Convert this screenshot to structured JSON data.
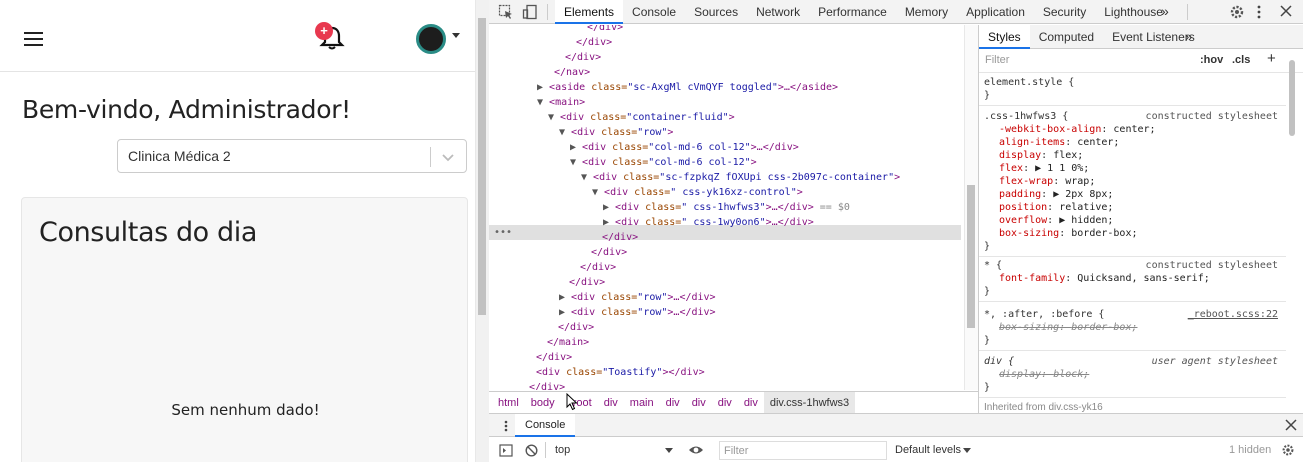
{
  "app": {
    "welcome": "Bem-vindo, Administrador!",
    "clinic_selected": "Clinica Médica 2",
    "notification_badge": "+",
    "card_title": "Consultas do dia",
    "empty_message": "Sem nenhum dado!"
  },
  "devtools": {
    "tabs": [
      "Elements",
      "Console",
      "Sources",
      "Network",
      "Performance",
      "Memory",
      "Application",
      "Security",
      "Lighthouse"
    ],
    "more_tabs": "»",
    "dom": [
      {
        "text": "</div>"
      },
      {
        "text": "</div>"
      },
      {
        "text": "</div>"
      },
      {
        "text": "</nav>"
      },
      {
        "tw": "▶",
        "tag": "<aside",
        "attr": " class=",
        "val": "\"sc-AxgMl cVmQYF toggled\"",
        "rest": ">…</aside>"
      },
      {
        "tw": "▼",
        "tag": "<main>"
      },
      {
        "tw": "▼",
        "tag": "<div",
        "attr": " class=",
        "val": "\"container-fluid\"",
        "rest": ">"
      },
      {
        "tw": "▼",
        "tag": "<div",
        "attr": " class=",
        "val": "\"row\"",
        "rest": ">"
      },
      {
        "tw": "▶",
        "tag": "<div",
        "attr": " class=",
        "val": "\"col-md-6 col-12\"",
        "rest": ">…</div>"
      },
      {
        "tw": "▼",
        "tag": "<div",
        "attr": " class=",
        "val": "\"col-md-6 col-12\"",
        "rest": ">"
      },
      {
        "tw": "▼",
        "tag": "<div",
        "attr": " class=",
        "val": "\"sc-fzpkqZ fOXUpi css-2b097c-container\"",
        "rest": ">"
      },
      {
        "tw": "▼",
        "tag": "<div",
        "attr": " class=",
        "val": "\" css-yk16xz-control\"",
        "rest": ">"
      },
      {
        "tw": "▶",
        "tag": "<div",
        "attr": " class=",
        "val": "\" css-1hwfws3\"",
        "rest": ">…</div>",
        "eq": " == $0"
      },
      {
        "tw": "▶",
        "tag": "<div",
        "attr": " class=",
        "val": "\" css-1wy0on6\"",
        "rest": ">…</div>"
      },
      {
        "text": "</div>"
      },
      {
        "text": "</div>"
      },
      {
        "text": "</div>"
      },
      {
        "text": "</div>"
      },
      {
        "tw": "▶",
        "tag": "<div",
        "attr": " class=",
        "val": "\"row\"",
        "rest": ">…</div>"
      },
      {
        "tw": "▶",
        "tag": "<div",
        "attr": " class=",
        "val": "\"row\"",
        "rest": ">…</div>"
      },
      {
        "text": "</div>"
      },
      {
        "text": "</main>"
      },
      {
        "text": "</div>"
      },
      {
        "tag": "<div",
        "attr": " class=",
        "val": "\"Toastify\"",
        "rest": "></div>"
      },
      {
        "text": "</div>"
      }
    ],
    "dom_dots": "•••",
    "breadcrumbs": [
      "html",
      "body",
      "#root",
      "div",
      "main",
      "div",
      "div",
      "div",
      "div",
      "div.css-1hwfws3"
    ],
    "styles": {
      "tabs": [
        "Styles",
        "Computed",
        "Event Listeners"
      ],
      "more": "»",
      "filter_placeholder": "Filter",
      "hov": ":hov",
      "cls": ".cls",
      "add": "+",
      "rules": [
        {
          "selector": "element.style {",
          "origin": "",
          "props": [],
          "close": "}"
        },
        {
          "selector": ".css-1hwfws3 {",
          "origin": "constructed stylesheet",
          "props": [
            {
              "p": "-webkit-box-align",
              "v": "center;"
            },
            {
              "p": "align-items",
              "v": "center;"
            },
            {
              "p": "display",
              "v": "flex;"
            },
            {
              "p": "flex",
              "v": "▶ 1 1 0%;"
            },
            {
              "p": "flex-wrap",
              "v": "wrap;"
            },
            {
              "p": "padding",
              "v": "▶ 2px 8px;"
            },
            {
              "p": "position",
              "v": "relative;"
            },
            {
              "p": "overflow",
              "v": "▶ hidden;"
            },
            {
              "p": "box-sizing",
              "v": "border-box;"
            }
          ],
          "close": "}"
        },
        {
          "selector": "* {",
          "origin": "constructed stylesheet",
          "props": [
            {
              "p": "font-family",
              "v": "Quicksand, sans-serif;"
            }
          ],
          "close": "}"
        },
        {
          "selector": "*, :after, :before {",
          "origin": "_reboot.scss:22",
          "props": [
            {
              "p": "box-sizing",
              "v": "border-box;",
              "struck": true
            }
          ],
          "close": "}"
        },
        {
          "selector": "div {",
          "origin": "user agent stylesheet",
          "props": [
            {
              "p": "display",
              "v": "block;",
              "struck": true
            }
          ],
          "close": "}"
        },
        {
          "selector": "Inherited from div.css-yk16",
          "origin": "",
          "props": [],
          "close": ""
        }
      ]
    },
    "console": {
      "tab": "Console",
      "context": "top",
      "filter_placeholder": "Filter",
      "levels": "Default levels",
      "hidden": "1 hidden"
    }
  }
}
